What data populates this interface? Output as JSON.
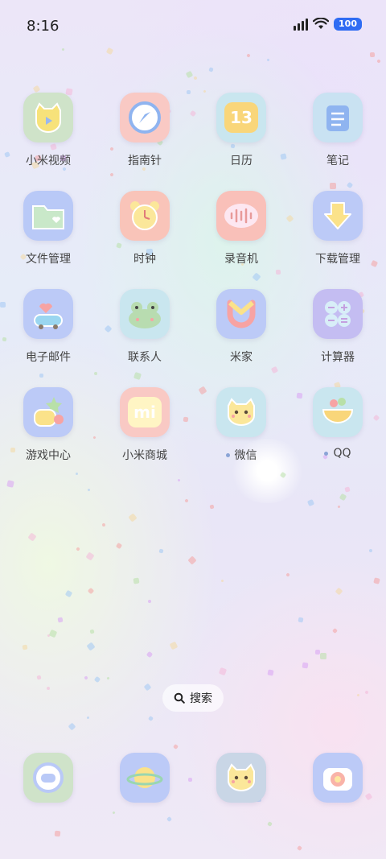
{
  "status_bar": {
    "time": "8:16",
    "battery": "100"
  },
  "apps": [
    [
      {
        "label": "小米视频",
        "icon": "video-cat-icon",
        "bg": "#cfe3c9",
        "fg": "#f7e27a"
      },
      {
        "label": "指南针",
        "icon": "compass-icon",
        "bg": "#f9c9c4",
        "fg": "#8fb4f0"
      },
      {
        "label": "日历",
        "icon": "calendar-icon",
        "bg": "#c9e6ef",
        "fg": "#f9d67a",
        "text": "13"
      },
      {
        "label": "笔记",
        "icon": "notes-icon",
        "bg": "#c9e2f2",
        "fg": "#8fb4f0"
      }
    ],
    [
      {
        "label": "文件管理",
        "icon": "folder-icon",
        "bg": "#b9c9f7",
        "fg": "#c9e8c9"
      },
      {
        "label": "时钟",
        "icon": "alarm-clock-icon",
        "bg": "#f9c4b9",
        "fg": "#fbe79a"
      },
      {
        "label": "录音机",
        "icon": "recorder-icon",
        "bg": "#f9c0b9",
        "fg": "#fde7f1"
      },
      {
        "label": "下载管理",
        "icon": "download-icon",
        "bg": "#bccaf7",
        "fg": "#fbe28a"
      }
    ],
    [
      {
        "label": "电子邮件",
        "icon": "mail-bus-icon",
        "bg": "#bccaf7",
        "fg": "#9ad6f0"
      },
      {
        "label": "联系人",
        "icon": "frog-icon",
        "bg": "#c9e6ef",
        "fg": "#b8dcb0"
      },
      {
        "label": "米家",
        "icon": "mijia-icon",
        "bg": "#bccaf7",
        "fg": "#fbe28a"
      },
      {
        "label": "计算器",
        "icon": "calculator-icon",
        "bg": "#c4bdf2",
        "fg": "#d8eef8"
      }
    ],
    [
      {
        "label": "游戏中心",
        "icon": "game-star-icon",
        "bg": "#bccaf7",
        "fg": "#fbe28a"
      },
      {
        "label": "小米商城",
        "icon": "mi-store-icon",
        "bg": "#f9c9c4",
        "fg": "#fff5c4",
        "text": "mi"
      },
      {
        "label": "微信",
        "icon": "wechat-cat-icon",
        "bg": "#c9e6ef",
        "fg": "#fbe79a",
        "dot": true
      },
      {
        "label": "QQ",
        "icon": "qq-bowl-icon",
        "bg": "#c9e6ef",
        "fg": "#f9d67a",
        "dot": true
      }
    ]
  ],
  "search": {
    "label": "搜索"
  },
  "dock": [
    {
      "icon": "phone-icon",
      "bg": "#cfe3c9",
      "fg": "#b9c9f7"
    },
    {
      "icon": "planet-icon",
      "bg": "#bccaf7",
      "fg": "#fbe28a"
    },
    {
      "icon": "cat-face-icon",
      "bg": "#c9d6e6",
      "fg": "#fbe79a"
    },
    {
      "icon": "camera-icon",
      "bg": "#bccaf7",
      "fg": "#f9b3a8"
    }
  ]
}
